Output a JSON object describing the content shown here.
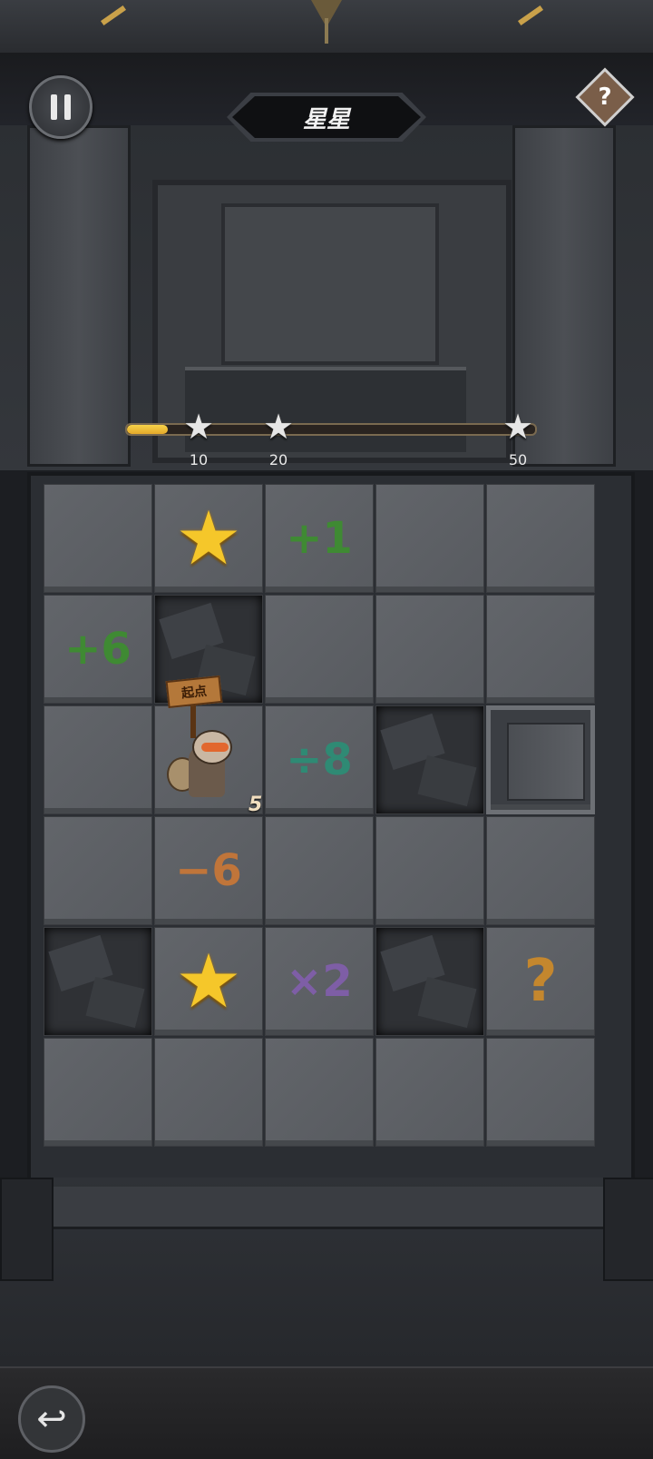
{
  "header": {
    "title": "星星",
    "help_label": "?",
    "back_icon": "↩"
  },
  "progress": {
    "fill_fraction": 0.1,
    "milestones": [
      {
        "label": "10"
      },
      {
        "label": "20"
      },
      {
        "label": "50"
      }
    ]
  },
  "board": {
    "start_label": "起点",
    "hero_steps": "5",
    "tiles": {
      "r0c2": "+1",
      "r1c0": "+6",
      "r2c2": "÷8",
      "r3c1": "−6",
      "r4c2": "×2",
      "r4c4": "?"
    },
    "colors": {
      "add": "#3f8a33",
      "divide": "#2f8a74",
      "subtract": "#c0753a",
      "multiply": "#7e5ea6",
      "question": "#c4872e",
      "star": "#f5c72a"
    },
    "icons": {
      "star_tile": "★",
      "milestone_star": "★"
    }
  }
}
